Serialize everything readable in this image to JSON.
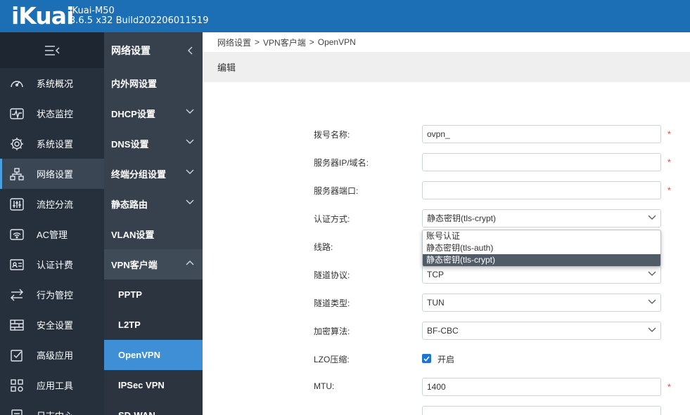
{
  "header": {
    "logo": "iKuai",
    "model": "iKuai-M50",
    "build": "3.6.5 x32 Build202206011519",
    "color": "#1c6fb5"
  },
  "nav_primary": {
    "items": [
      {
        "label": "系统概况",
        "icon": "dashboard-icon"
      },
      {
        "label": "状态监控",
        "icon": "pulse-icon"
      },
      {
        "label": "系统设置",
        "icon": "gear-icon"
      },
      {
        "label": "网络设置",
        "icon": "network-icon",
        "active": true
      },
      {
        "label": "流控分流",
        "icon": "sliders-icon"
      },
      {
        "label": "AC管理",
        "icon": "wifi-router-icon"
      },
      {
        "label": "认证计费",
        "icon": "id-card-icon"
      },
      {
        "label": "行为管控",
        "icon": "arrows-icon"
      },
      {
        "label": "安全设置",
        "icon": "firewall-icon"
      },
      {
        "label": "高级应用",
        "icon": "checkbox-icon"
      },
      {
        "label": "应用工具",
        "icon": "apps-icon"
      },
      {
        "label": "日志中心",
        "icon": "log-icon"
      }
    ]
  },
  "nav_secondary": {
    "title": "网络设置",
    "items": [
      {
        "label": "内外网设置"
      },
      {
        "label": "DHCP设置"
      },
      {
        "label": "DNS设置"
      },
      {
        "label": "终端分组设置"
      },
      {
        "label": "静态路由"
      },
      {
        "label": "VLAN设置"
      },
      {
        "label": "VPN客户端"
      }
    ],
    "vpn_sub": [
      {
        "label": "PPTP"
      },
      {
        "label": "L2TP"
      },
      {
        "label": "OpenVPN",
        "active": true
      },
      {
        "label": "IPSec VPN"
      },
      {
        "label": "SD-WAN"
      }
    ]
  },
  "breadcrumb": [
    "网络设置",
    "VPN客户端",
    "OpenVPN"
  ],
  "breadcrumb_sep": ">",
  "edit_title": "编辑",
  "form": {
    "name_label": "拨号名称:",
    "name_value": "ovpn_",
    "server_label": "服务器IP/域名:",
    "server_value": "",
    "port_label": "服务器端口:",
    "port_value": "",
    "auth_label": "认证方式:",
    "auth_value": "静态密钥(tls-crypt)",
    "line_label": "线路:",
    "proto_label": "隧道协议:",
    "proto_value": "TCP",
    "type_label": "隧道类型:",
    "type_value": "TUN",
    "cipher_label": "加密算法:",
    "cipher_value": "BF-CBC",
    "lzo_label": "LZO压缩:",
    "lzo_checked": true,
    "lzo_text": "开启",
    "mtu_label": "MTU:",
    "mtu_value": "1400",
    "required_mark": "*"
  },
  "auth_dropdown": {
    "options": [
      "账号认证",
      "静态密钥(tls-auth)",
      "静态密钥(tls-crypt)"
    ],
    "selected_index": 2
  }
}
